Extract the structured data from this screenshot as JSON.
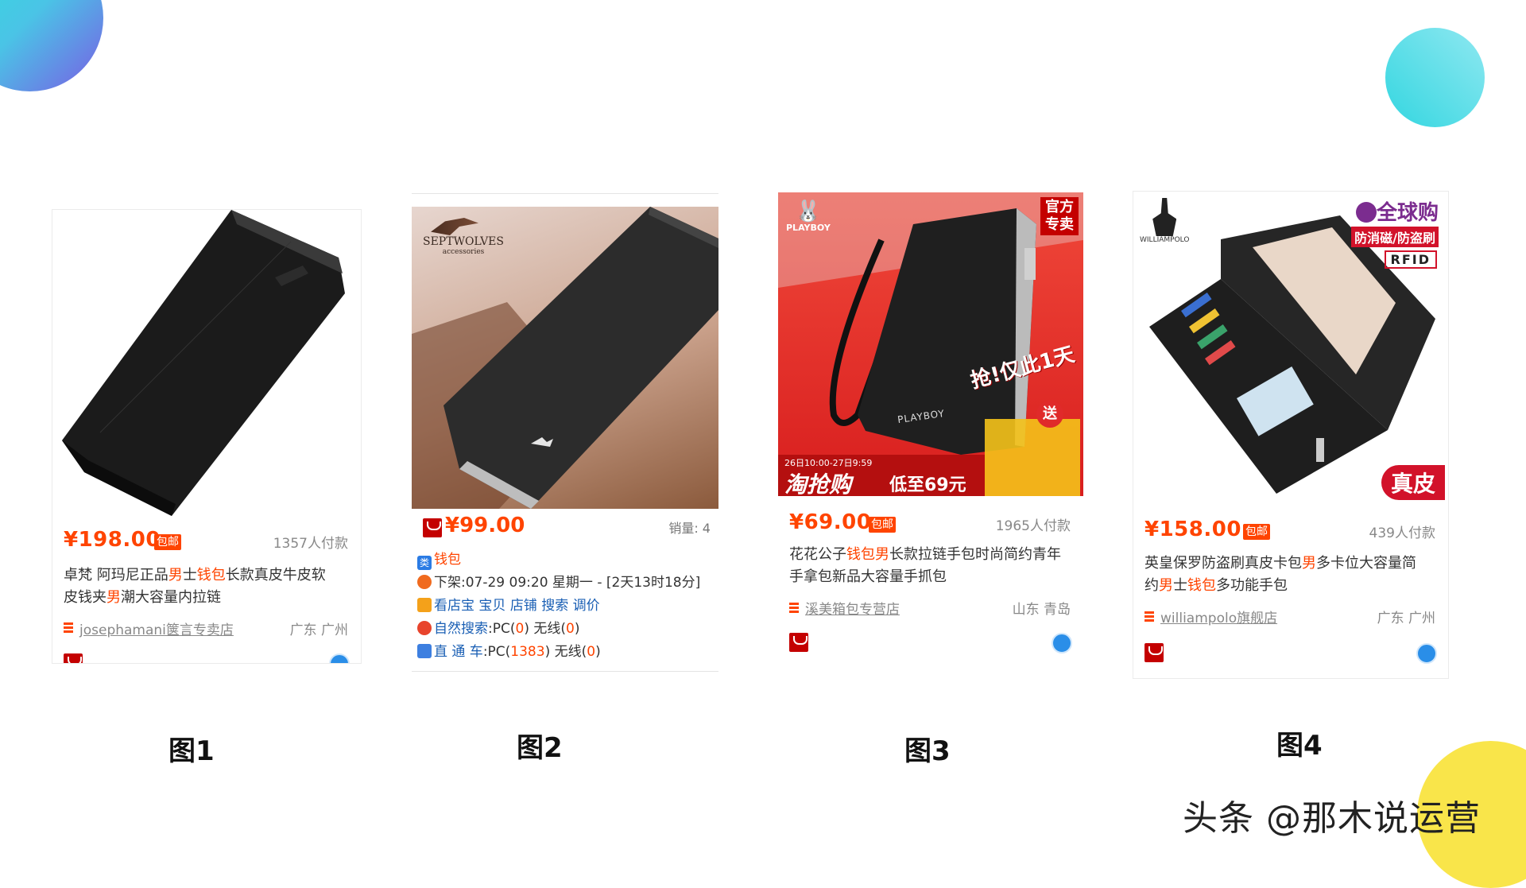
{
  "products": [
    {
      "price": "¥198.00",
      "baoyou": "包邮",
      "paid": "1357人付款",
      "title_parts": [
        "卓梵 阿玛尼正品",
        "男",
        "士",
        "钱包",
        "长款真皮牛皮软"
      ],
      "title_line2_parts": [
        "皮钱夹",
        "男",
        "潮大容量内拉链"
      ],
      "shop": "josephamani箧言专卖店",
      "location": "广东 广州",
      "caption": "图1"
    },
    {
      "brand": "SEPTWOLVES",
      "brand_sub": "accessories",
      "price": "¥99.00",
      "sales": "销量: 4",
      "category": "钱包",
      "listing": "下架:07-29 09:20 星期一 - [2天13时18分]",
      "tools": [
        "看店宝",
        "宝贝",
        "店铺",
        "搜索",
        "调价"
      ],
      "natural_search": {
        "label": "自然搜索",
        "pc_label": ":PC(",
        "pc": "0",
        "wireless_label": ") 无线(",
        "wireless": "0",
        "end": ")"
      },
      "direct_train": {
        "label": "直 通 车",
        "pc_label": ":PC(",
        "pc": "1383",
        "wireless_label": ") 无线(",
        "wireless": "0",
        "end": ")"
      },
      "caption": "图2"
    },
    {
      "brand": "PLAYBOY",
      "corner_tag": "官方\n专卖",
      "promo": "抢!仅此1天",
      "promo_time": "26日10:00-27日9:59",
      "promo_big": "淘抢购",
      "promo_price": "低至69元",
      "gift": "送",
      "wallet_brand": "PLAYBOY",
      "price": "¥69.00",
      "baoyou": "包邮",
      "paid": "1965人付款",
      "title_line1_parts": [
        "花花公子",
        "钱包",
        "男",
        "长款拉链手包时尚简约青年"
      ],
      "title_line2": "手拿包新品大容量手抓包",
      "shop": "溪美箱包专营店",
      "location": "山东 青岛",
      "caption": "图3"
    },
    {
      "brand": "WILLIAMPOLO",
      "global_tag": "全球购",
      "feature": "防消磁/防盗刷",
      "rfid": "RFID",
      "leather": "真皮",
      "price": "¥158.00",
      "baoyou": "包邮",
      "paid": "439人付款",
      "title_line1_parts": [
        "英皇保罗防盗刷真皮卡包",
        "男",
        "多卡位大容量简"
      ],
      "title_line2_parts": [
        "约",
        "男",
        "士",
        "钱包",
        "多功能手包"
      ],
      "shop": "williampolo旗舰店",
      "location": "广东 广州",
      "caption": "图4"
    }
  ],
  "watermark": "头条 @那木说运营",
  "colors": {
    "accent": "#ff4400",
    "link": "#1a5fb4"
  }
}
